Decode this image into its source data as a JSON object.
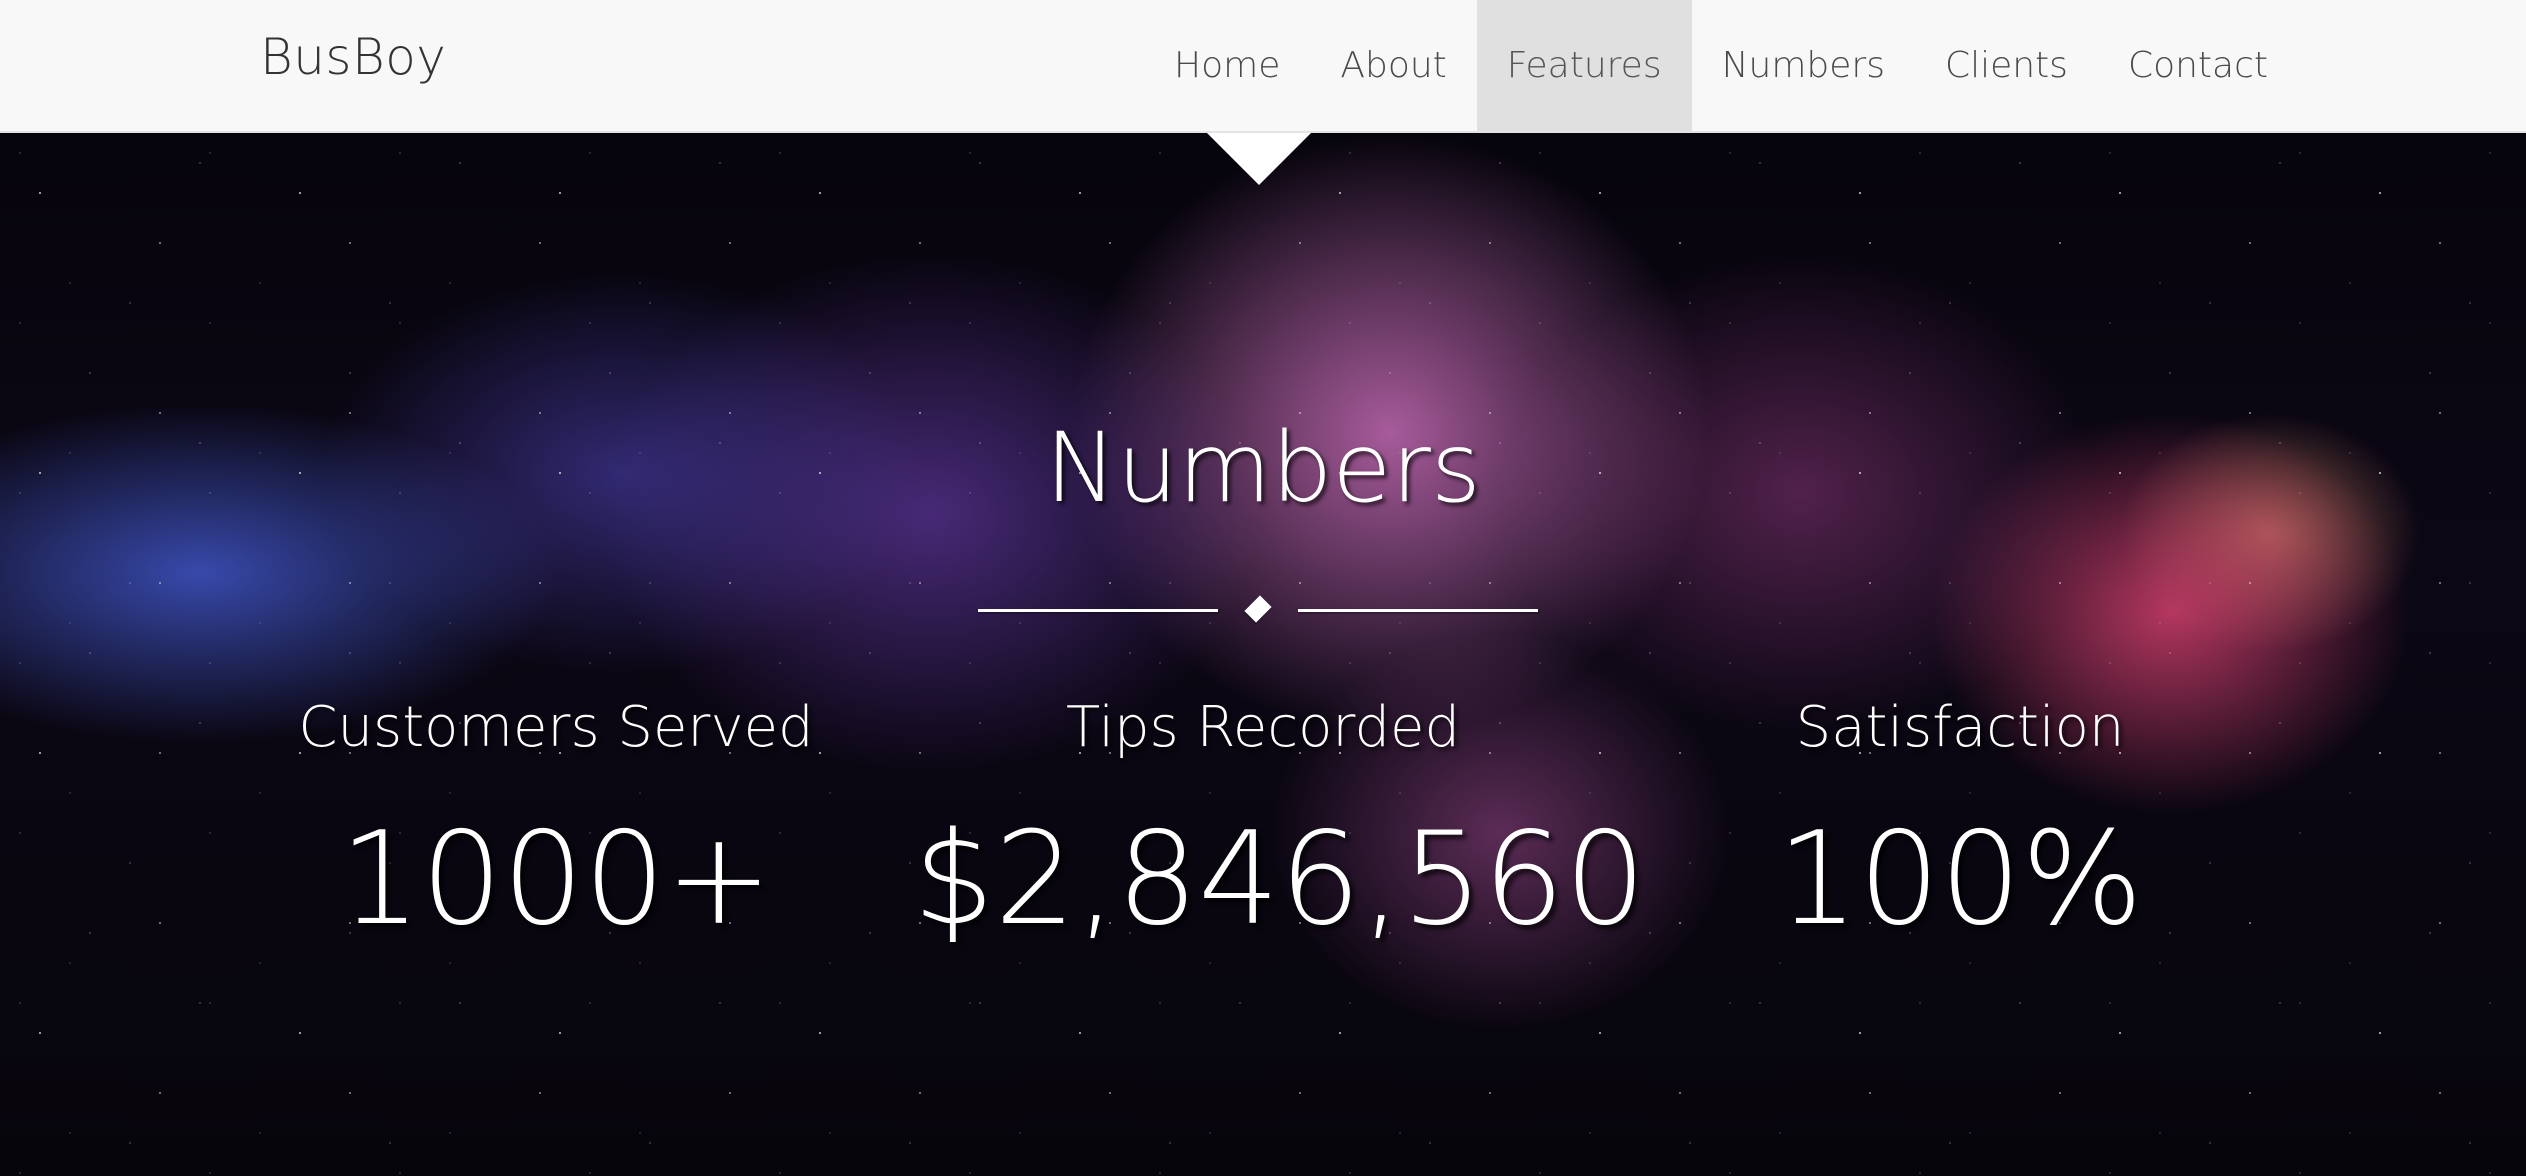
{
  "navbar": {
    "brand": "BusBoy",
    "items": [
      {
        "label": "Home"
      },
      {
        "label": "About"
      },
      {
        "label": "Features"
      },
      {
        "label": "Numbers"
      },
      {
        "label": "Clients"
      },
      {
        "label": "Contact"
      }
    ],
    "active_item": "Features"
  },
  "numbers": {
    "title": "Numbers",
    "stats": [
      {
        "label": "Customers Served",
        "value": "1000+"
      },
      {
        "label": "Tips Recorded",
        "value": "$2,846,560"
      },
      {
        "label": "Satisfaction",
        "value": "100%"
      }
    ]
  },
  "colors": {
    "navbar_bg": "#f8f8f8",
    "active_nav_bg": "#e0e0e0",
    "hero_text": "#ffffff"
  }
}
